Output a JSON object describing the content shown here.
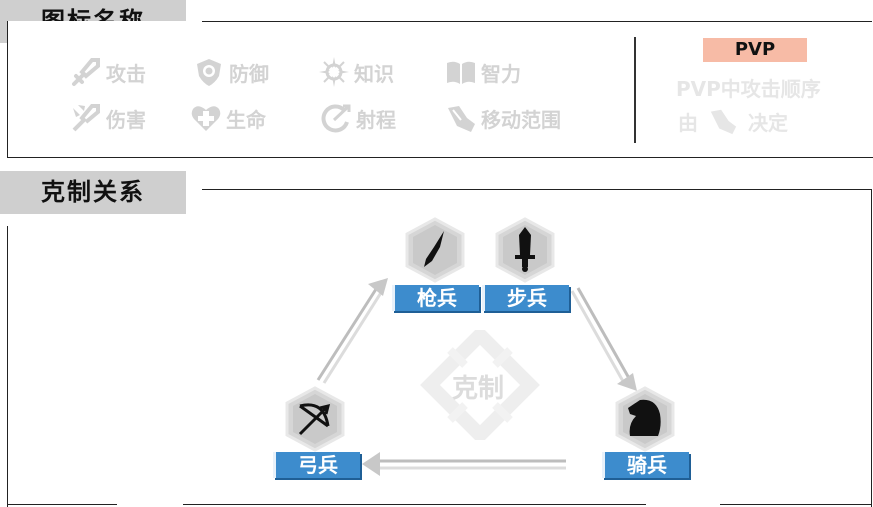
{
  "sections": {
    "icons_title": "图标名称",
    "relations_title": "克制关系"
  },
  "legend": [
    {
      "icon": "attack-icon",
      "label": "攻击"
    },
    {
      "icon": "defense-icon",
      "label": "防御"
    },
    {
      "icon": "intel-icon",
      "label": "知识"
    },
    {
      "icon": "wisdom-icon",
      "label": "智力"
    },
    {
      "icon": "damage-icon",
      "label": "伤害"
    },
    {
      "icon": "health-icon",
      "label": "生命"
    },
    {
      "icon": "range-icon",
      "label": "射程"
    },
    {
      "icon": "move-icon",
      "label": "移动范围"
    }
  ],
  "pvp": {
    "badge": "PVP",
    "line1": "PVP中攻击顺序",
    "line2_pre": "由",
    "line2_post": "决定"
  },
  "units": [
    {
      "name": "spear",
      "label": "枪兵"
    },
    {
      "name": "infantry",
      "label": "步兵"
    },
    {
      "name": "cavalry",
      "label": "骑兵"
    },
    {
      "name": "archer",
      "label": "弓兵"
    }
  ],
  "center_watermark": "克制",
  "colors": {
    "label_blue": "#3d8ccd",
    "tab_gray": "#cfcfcf",
    "pvp_badge": "#f7bba6",
    "legend_gray": "#d3d3d3"
  }
}
